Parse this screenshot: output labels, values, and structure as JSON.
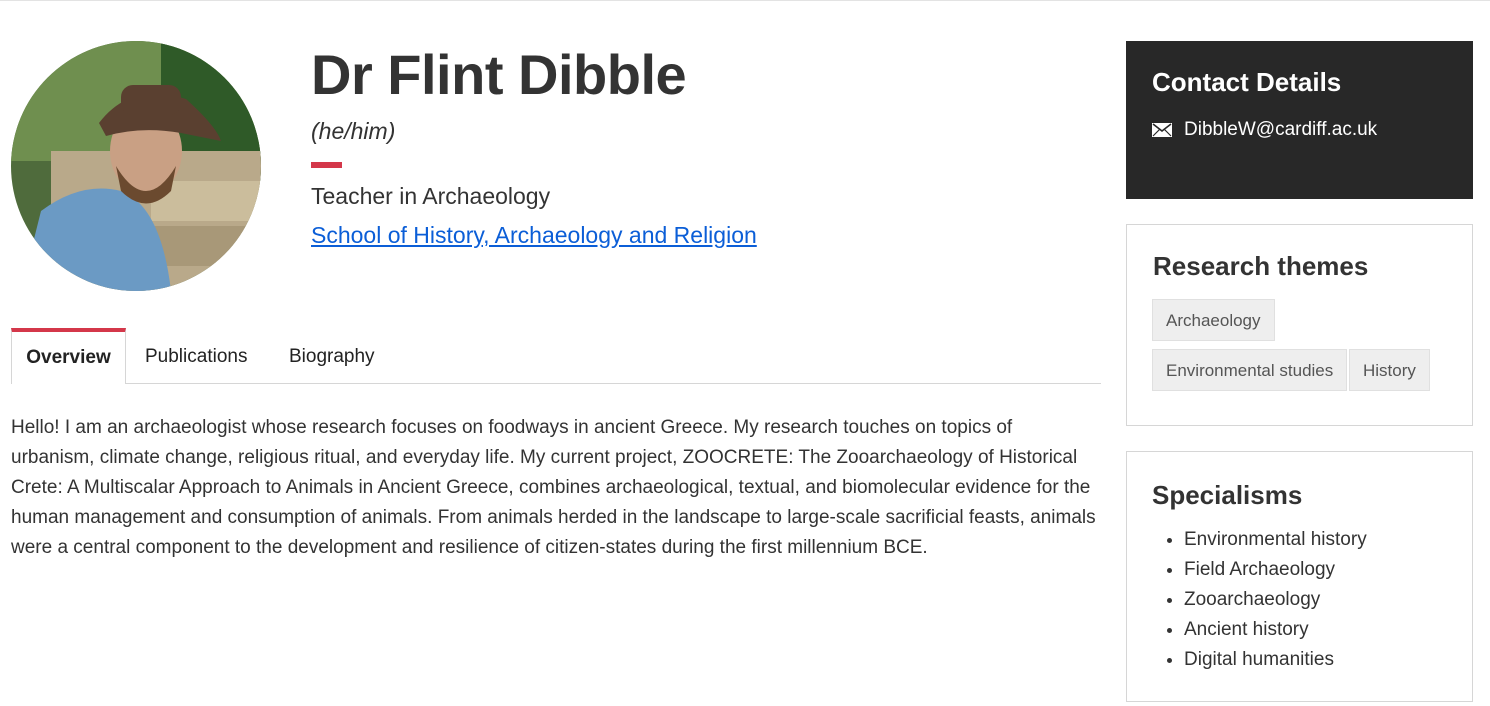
{
  "profile": {
    "name": "Dr Flint Dibble",
    "pronouns": "(he/him)",
    "role": "Teacher in Archaeology",
    "school": "School of History, Archaeology and Religion",
    "avatar_icon": "profile-photo"
  },
  "tabs": [
    {
      "label": "Overview",
      "active": true
    },
    {
      "label": "Publications",
      "active": false
    },
    {
      "label": "Biography",
      "active": false
    }
  ],
  "overview": {
    "text": "Hello! I am an archaeologist whose research focuses on foodways in ancient Greece. My research touches on topics of urbanism, climate change, religious ritual, and everyday life. My current project, ZOOCRETE: The Zooarchaeology of Historical Crete: A Multiscalar Approach to Animals in Ancient Greece, combines archaeological, textual, and biomolecular evidence for the human management and consumption of animals. From animals herded in the landscape to large-scale sacrificial feasts, animals were a central component to the development and resilience of citizen-states during the first millennium BCE."
  },
  "contact": {
    "title": "Contact Details",
    "email": "DibbleW@cardiff.ac.uk",
    "email_icon": "envelope-icon"
  },
  "research_themes": {
    "title": "Research themes",
    "tags": [
      "Archaeology",
      "Environmental studies",
      "History"
    ]
  },
  "specialisms": {
    "title": "Specialisms",
    "items": [
      "Environmental history",
      "Field Archaeology",
      "Zooarchaeology",
      "Ancient history",
      "Digital humanities"
    ]
  },
  "colors": {
    "accent": "#d4374a",
    "link": "#0b5ed7",
    "contact_bg": "#282828"
  }
}
